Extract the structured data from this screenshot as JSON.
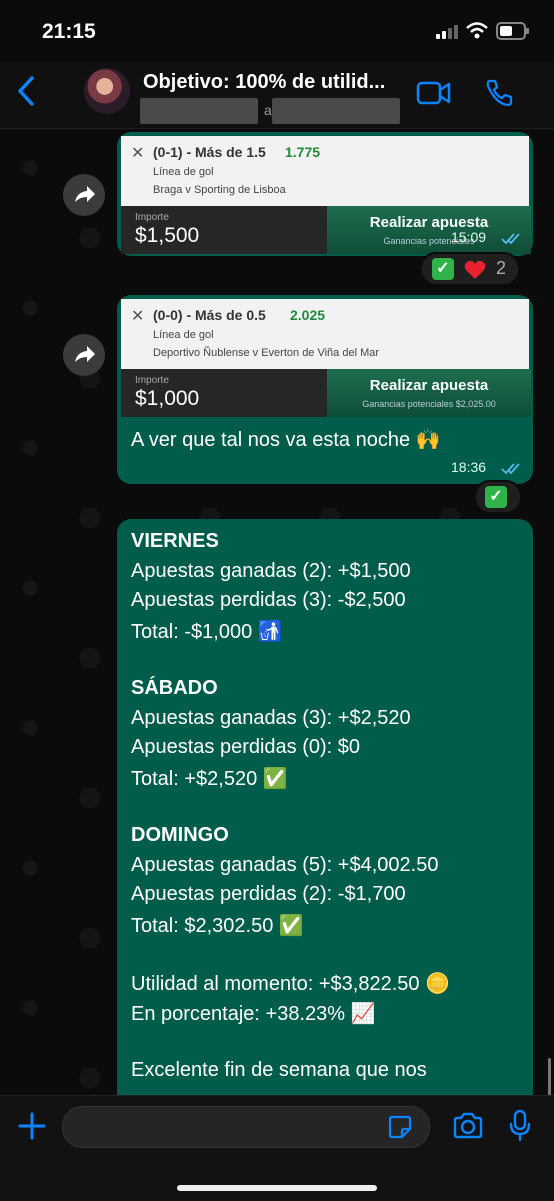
{
  "status": {
    "time": "21:15"
  },
  "header": {
    "title": "Objetivo: 100% de utilid...",
    "subtitle_fragment": "a"
  },
  "bets": [
    {
      "market": "(0-1) - Más de 1.5",
      "odds": "1.775",
      "type": "Línea de gol",
      "match": "Braga v Sporting de Lisboa",
      "importe_label": "Importe",
      "importe": "$1,500",
      "place_label": "Realizar apuesta",
      "potential": "Ganancias potenciales",
      "time": "15:09"
    },
    {
      "market": "(0-0) - Más de 0.5",
      "odds": "2.025",
      "type": "Línea de gol",
      "match": "Deportivo Ñublense v Everton de Viña del Mar",
      "importe_label": "Importe",
      "importe": "$1,000",
      "place_label": "Realizar apuesta",
      "potential": "Ganancias potenciales $2,025.00",
      "caption": "A ver que tal nos va esta noche 🙌",
      "time": "18:36"
    }
  ],
  "reactions": {
    "first_count": "2"
  },
  "summary": {
    "lines": [
      "VIERNES",
      "Apuestas ganadas (2): +$1,500",
      "Apuestas perdidas (3): -$2,500",
      "Total: -$1,000 🚮",
      "SÁBADO",
      "Apuestas ganadas (3): +$2,520",
      "Apuestas perdidas (0): $0",
      "Total: +$2,520 ✅",
      "DOMINGO",
      "Apuestas ganadas (5): +$4,002.50",
      "Apuestas perdidas (2): -$1,700",
      "Total: $2,302.50 ✅",
      "Utilidad al momento: +$3,822.50 🪙",
      "En porcentaje: +38.23% 📈",
      "Excelente fin de semana que nos"
    ]
  },
  "colors": {
    "bubble": "#005c4b",
    "accent": "#0a84ff",
    "odds": "#1f8a3a"
  }
}
